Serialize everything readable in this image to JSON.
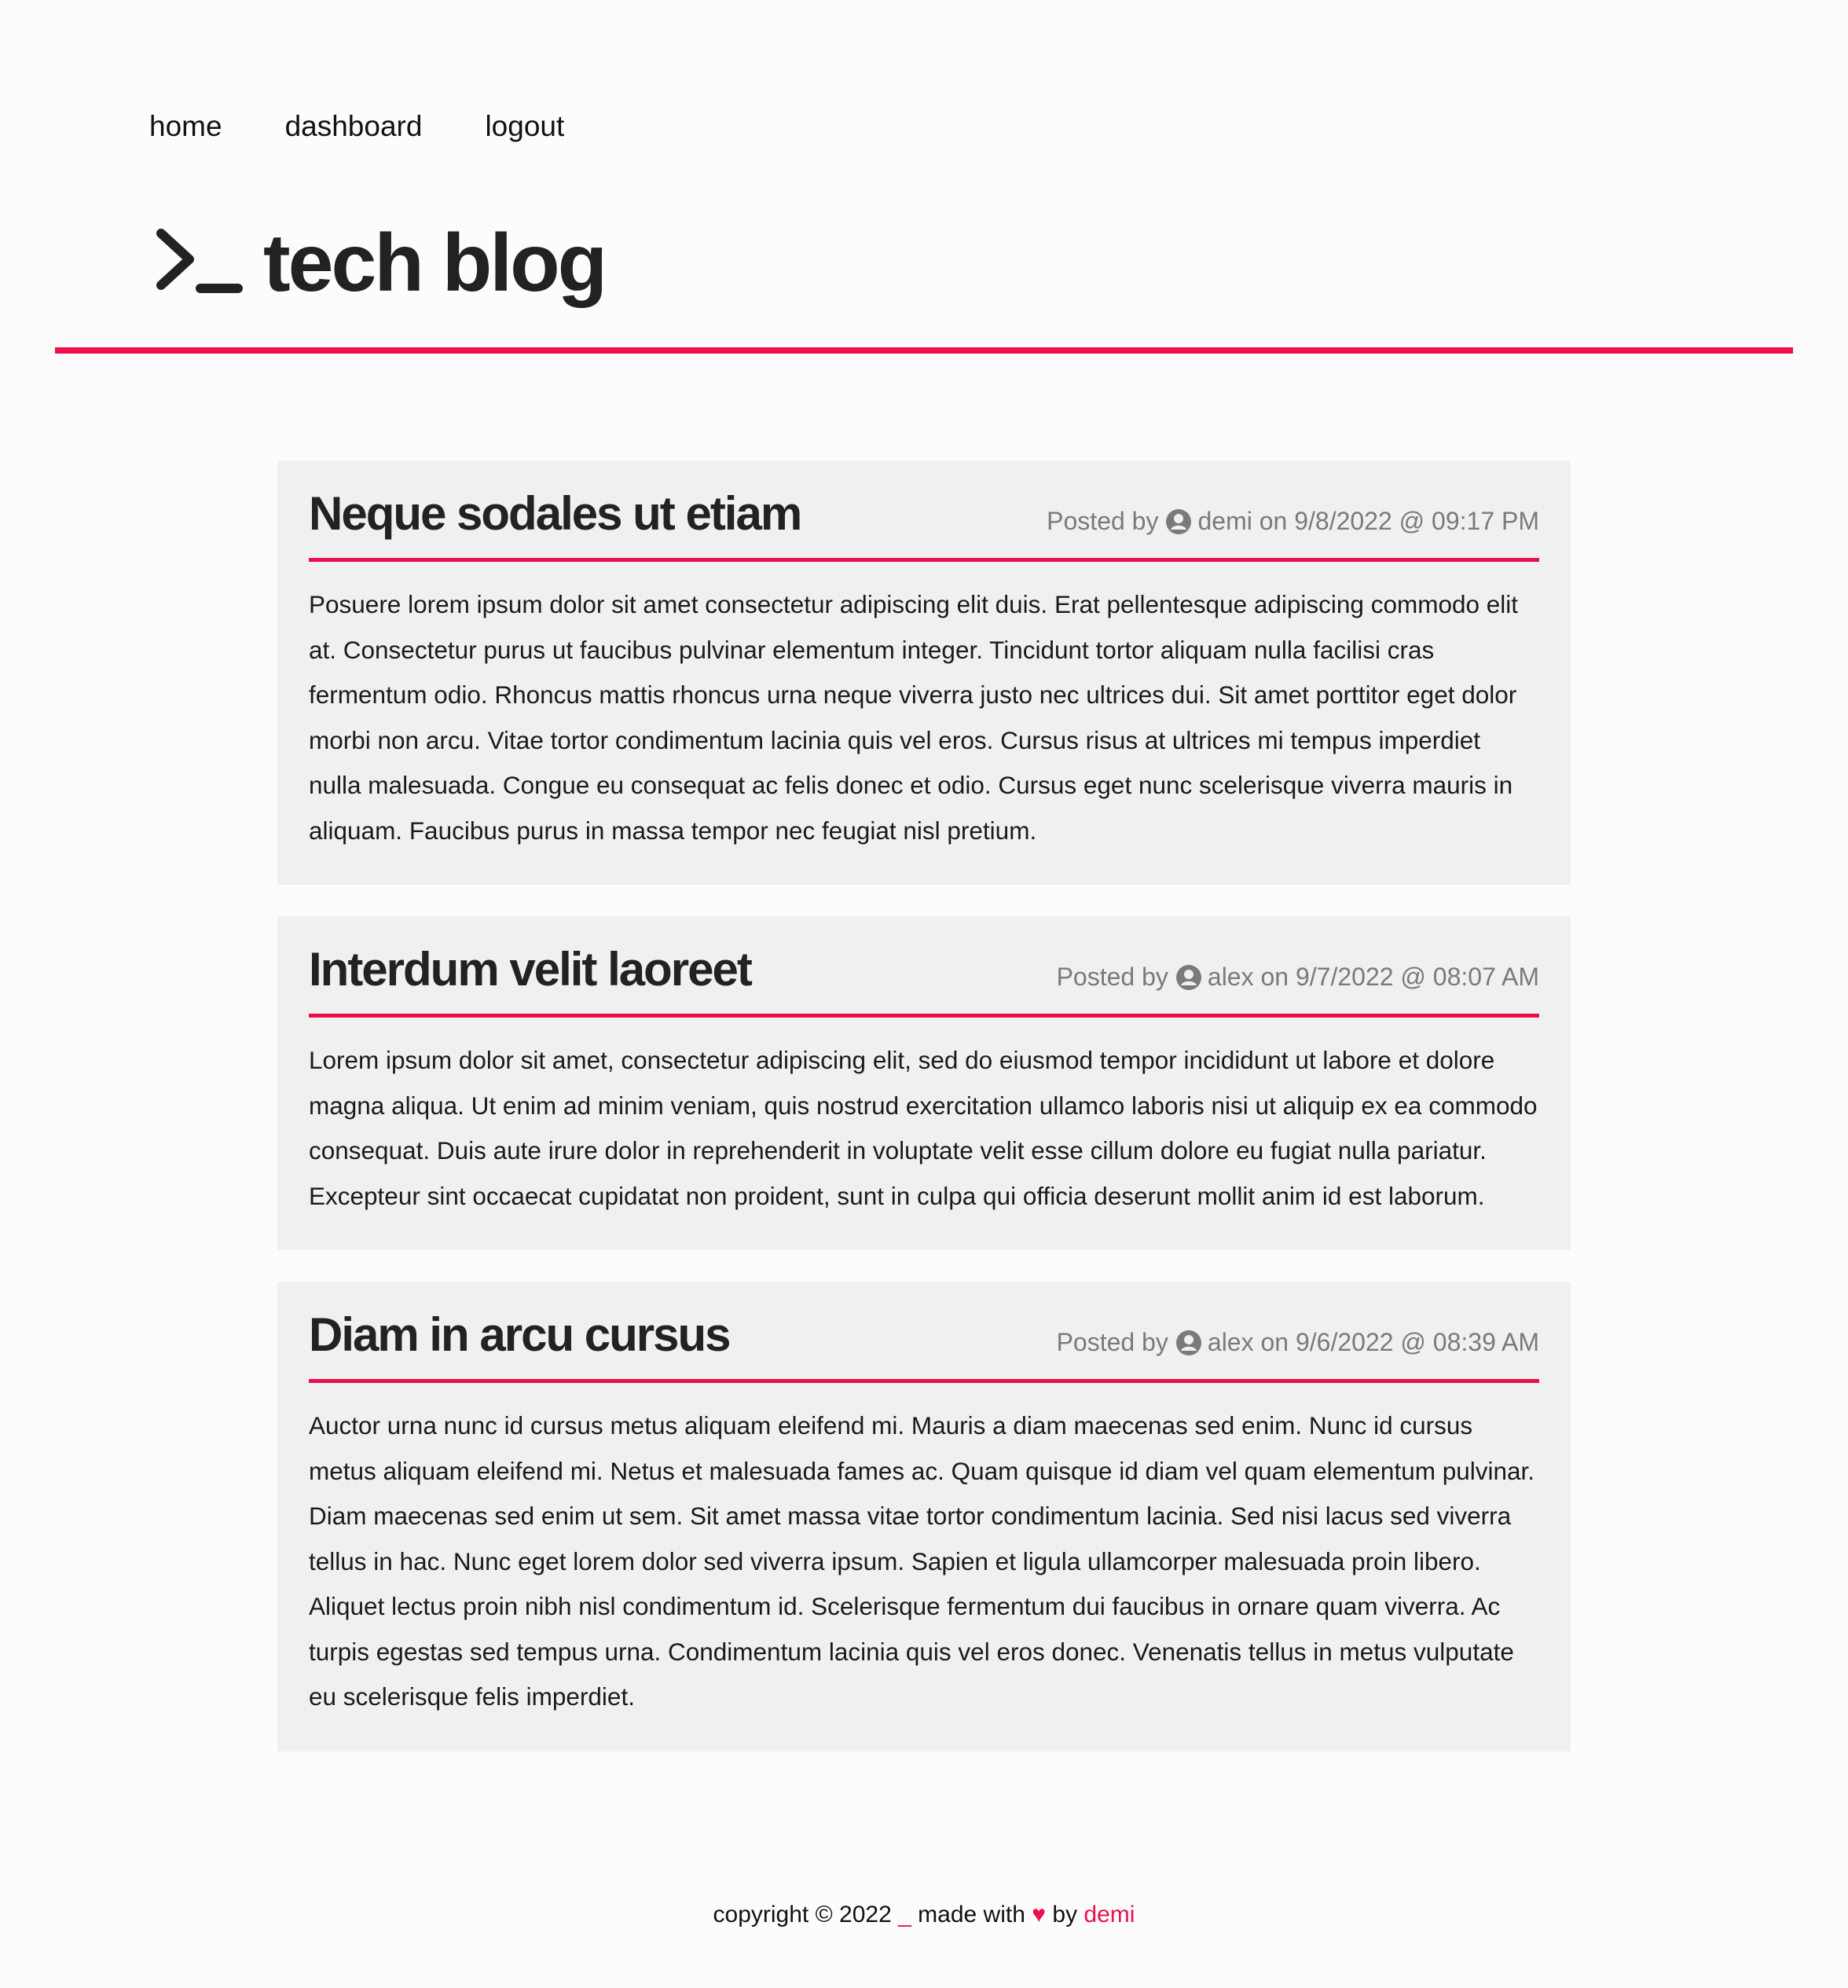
{
  "nav": {
    "items": [
      "home",
      "dashboard",
      "logout"
    ]
  },
  "header": {
    "title": "tech blog",
    "logo_icon": "terminal-prompt-icon"
  },
  "colors": {
    "accent": "#e8114d",
    "card_bg": "#f0f0f0",
    "page_bg": "#fcfcfc"
  },
  "posts": [
    {
      "title": "Neque sodales ut etiam",
      "posted_by_label": "Posted by",
      "author": "demi",
      "on_label": "on",
      "date": "9/8/2022 @ 09:17 PM",
      "body": "Posuere lorem ipsum dolor sit amet consectetur adipiscing elit duis. Erat pellentesque adipiscing commodo elit at. Consectetur purus ut faucibus pulvinar elementum integer. Tincidunt tortor aliquam nulla facilisi cras fermentum odio. Rhoncus mattis rhoncus urna neque viverra justo nec ultrices dui. Sit amet porttitor eget dolor morbi non arcu. Vitae tortor condimentum lacinia quis vel eros. Cursus risus at ultrices mi tempus imperdiet nulla malesuada. Congue eu consequat ac felis donec et odio. Cursus eget nunc scelerisque viverra mauris in aliquam. Faucibus purus in massa tempor nec feugiat nisl pretium."
    },
    {
      "title": "Interdum velit laoreet",
      "posted_by_label": "Posted by",
      "author": "alex",
      "on_label": "on",
      "date": "9/7/2022 @ 08:07 AM",
      "body": "Lorem ipsum dolor sit amet, consectetur adipiscing elit, sed do eiusmod tempor incididunt ut labore et dolore magna aliqua. Ut enim ad minim veniam, quis nostrud exercitation ullamco laboris nisi ut aliquip ex ea commodo consequat. Duis aute irure dolor in reprehenderit in voluptate velit esse cillum dolore eu fugiat nulla pariatur. Excepteur sint occaecat cupidatat non proident, sunt in culpa qui officia deserunt mollit anim id est laborum."
    },
    {
      "title": "Diam in arcu cursus",
      "posted_by_label": "Posted by",
      "author": "alex",
      "on_label": "on",
      "date": "9/6/2022 @ 08:39 AM",
      "body": "Auctor urna nunc id cursus metus aliquam eleifend mi. Mauris a diam maecenas sed enim. Nunc id cursus metus aliquam eleifend mi. Netus et malesuada fames ac. Quam quisque id diam vel quam elementum pulvinar. Diam maecenas sed enim ut sem. Sit amet massa vitae tortor condimentum lacinia. Sed nisi lacus sed viverra tellus in hac. Nunc eget lorem dolor sed viverra ipsum. Sapien et ligula ullamcorper malesuada proin libero. Aliquet lectus proin nibh nisl condimentum id. Scelerisque fermentum dui faucibus in ornare quam viverra. Ac turpis egestas sed tempus urna. Condimentum lacinia quis vel eros donec. Venenatis tellus in metus vulputate eu scelerisque felis imperdiet."
    }
  ],
  "footer": {
    "copyright": "copyright © 2022",
    "underscore": "_",
    "made_with": "made with",
    "heart": "♥",
    "by": "by",
    "author": "demi"
  }
}
